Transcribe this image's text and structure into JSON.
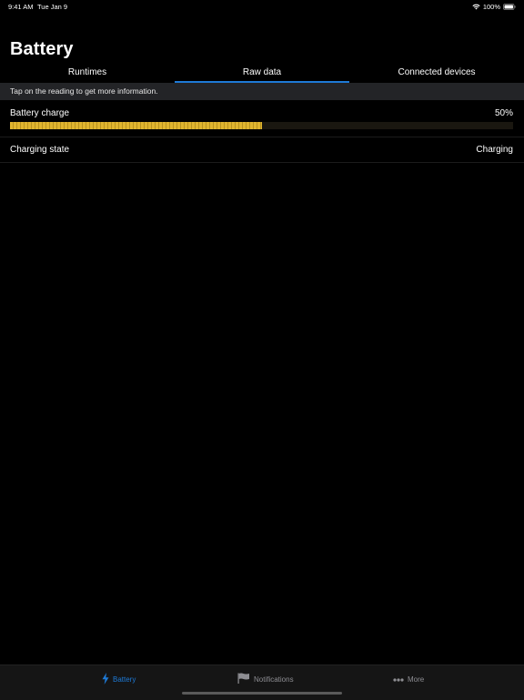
{
  "status_bar": {
    "time": "9:41 AM",
    "date": "Tue Jan 9",
    "battery_percent": "100%"
  },
  "page": {
    "title": "Battery"
  },
  "tabs": [
    {
      "label": "Runtimes",
      "active": false
    },
    {
      "label": "Raw data",
      "active": true
    },
    {
      "label": "Connected devices",
      "active": false
    }
  ],
  "hint": "Tap on the reading to get more information.",
  "readings": {
    "battery_charge": {
      "label": "Battery charge",
      "value": "50%",
      "fraction": 0.5
    },
    "charging_state": {
      "label": "Charging state",
      "value": "Charging"
    }
  },
  "tabbar": [
    {
      "label": "Battery",
      "icon": "bolt-icon",
      "active": true
    },
    {
      "label": "Notifications",
      "icon": "flag-icon",
      "active": false
    },
    {
      "label": "More",
      "icon": "ellipsis-icon",
      "active": false
    }
  ],
  "colors": {
    "accent": "#1e7ad6",
    "charge": "#e0b52f",
    "hint_bg": "#232427"
  }
}
